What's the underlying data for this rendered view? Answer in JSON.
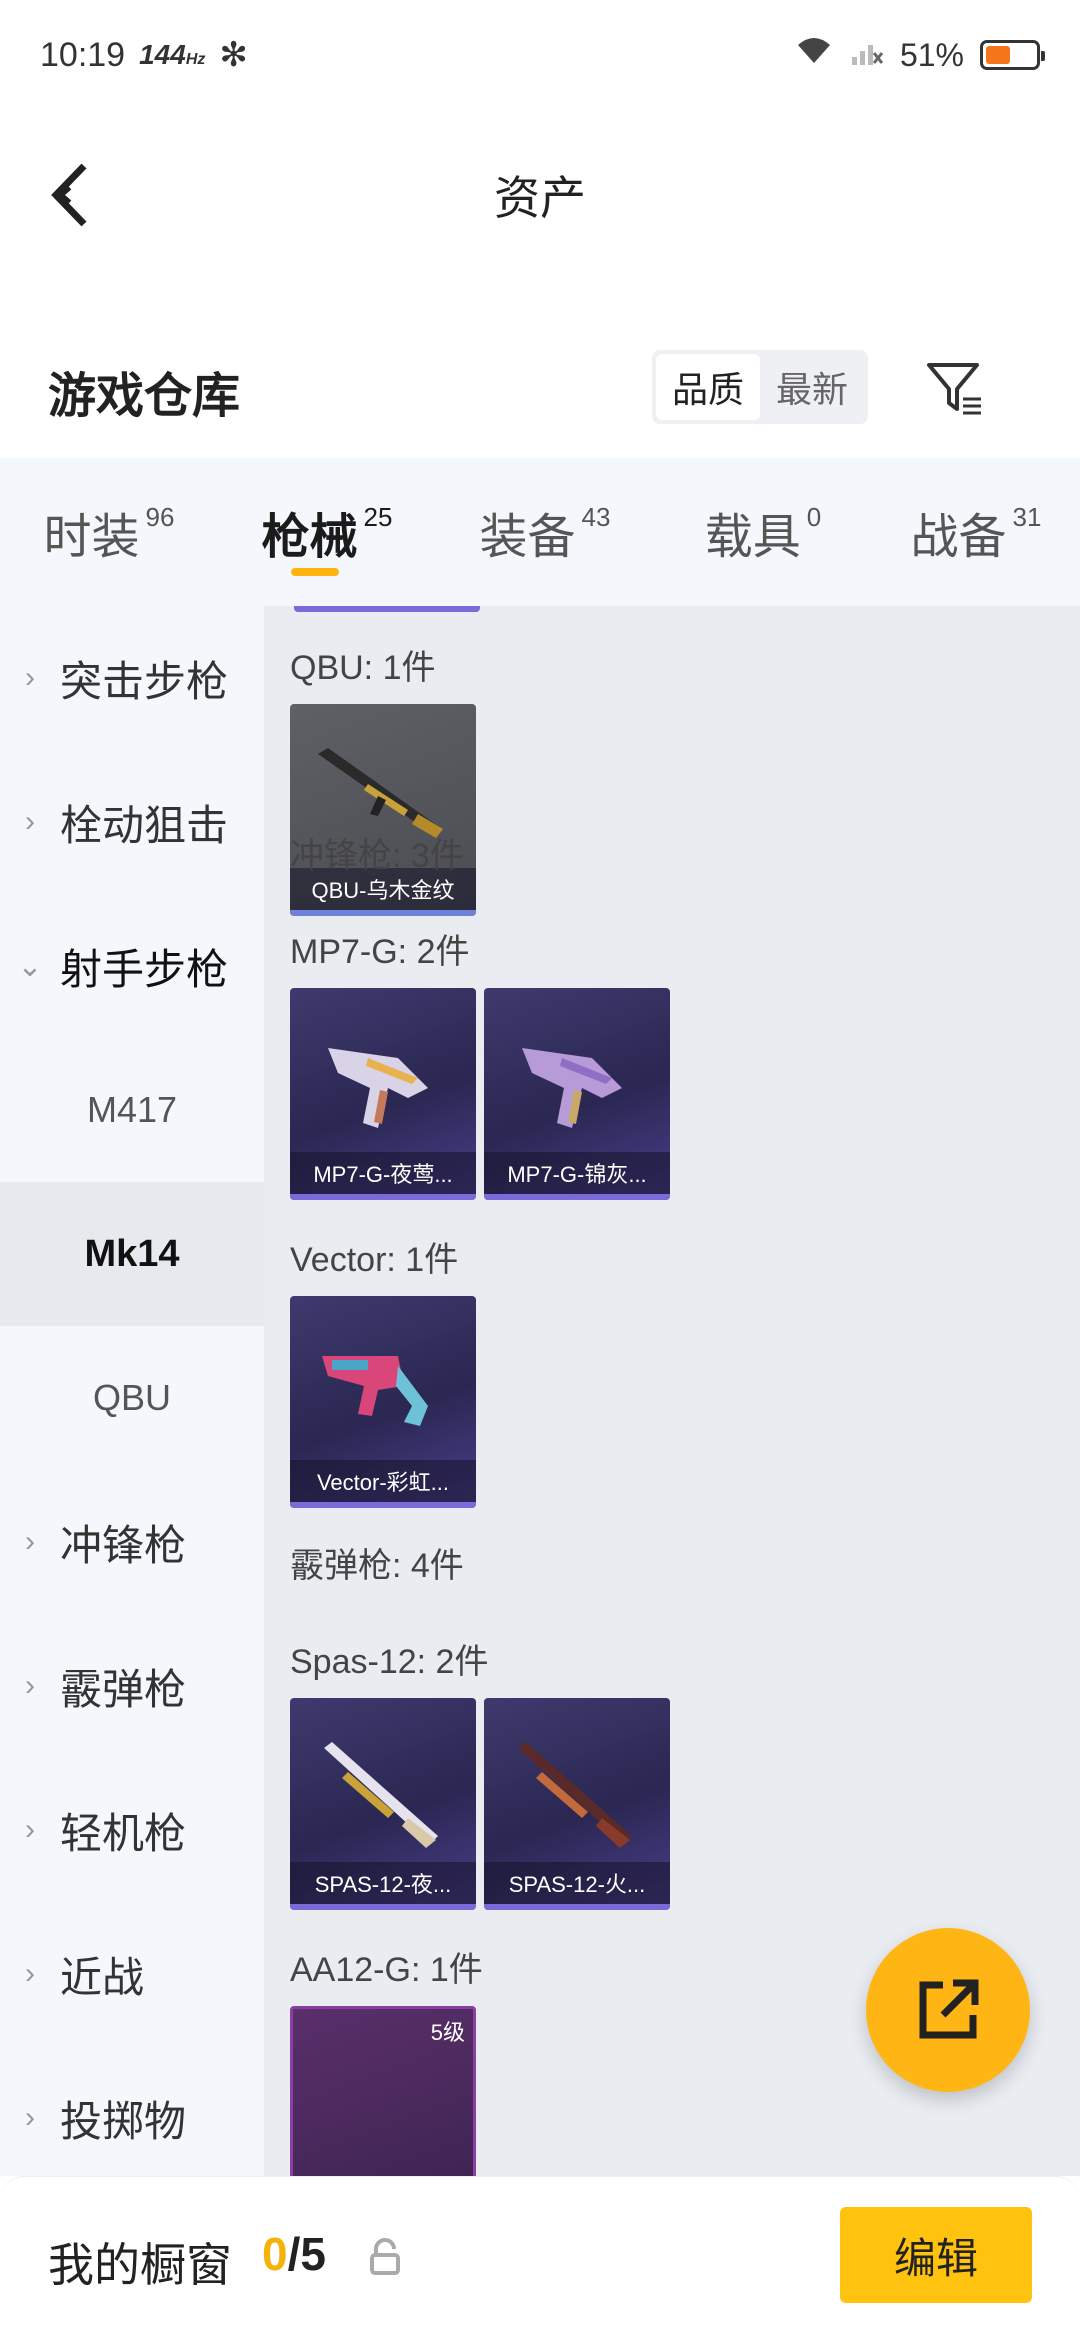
{
  "status": {
    "time": "10:19",
    "refresh_rate": "144",
    "refresh_unit": "Hz",
    "battery": "51%",
    "battery_level": 0.51
  },
  "header": {
    "title": "资产"
  },
  "warehouse": {
    "title": "游戏仓库",
    "sort_options": [
      "品质",
      "最新"
    ],
    "sort_selected": "品质"
  },
  "tabs": [
    {
      "label": "时装",
      "count": "96"
    },
    {
      "label": "枪械",
      "count": "25",
      "active": true
    },
    {
      "label": "装备",
      "count": "43"
    },
    {
      "label": "载具",
      "count": "0"
    },
    {
      "label": "战备",
      "count": "31"
    }
  ],
  "sidebar": {
    "categories": [
      {
        "label": "突击步枪"
      },
      {
        "label": "栓动狙击"
      },
      {
        "label": "射手步枪",
        "open": true
      },
      {
        "label": "冲锋枪"
      },
      {
        "label": "霰弹枪"
      },
      {
        "label": "轻机枪"
      },
      {
        "label": "近战"
      },
      {
        "label": "投掷物"
      }
    ],
    "subitems": [
      {
        "label": "M417"
      },
      {
        "label": "Mk14",
        "selected": true
      },
      {
        "label": "QBU"
      }
    ]
  },
  "content": {
    "groups": [
      {
        "title": "QBU: 1件",
        "items": [
          "QBU-乌木金纹"
        ]
      },
      {
        "title": "冲锋枪: 3件"
      },
      {
        "title": "MP7-G: 2件",
        "items": [
          "MP7-G-夜莺...",
          "MP7-G-锦灰..."
        ]
      },
      {
        "title": "Vector: 1件",
        "items": [
          "Vector-彩虹..."
        ]
      },
      {
        "title": "霰弹枪: 4件"
      },
      {
        "title": "Spas-12: 2件",
        "items": [
          "SPAS-12-夜...",
          "SPAS-12-火..."
        ]
      },
      {
        "title": "AA12-G: 1件",
        "items_level": [
          "5级"
        ]
      }
    ]
  },
  "bottom": {
    "title": "我的橱窗",
    "used": "0",
    "separator": "/",
    "total": "5",
    "edit_label": "编辑"
  },
  "colors": {
    "accent": "#ffc20e",
    "fab": "#ffb513",
    "tab_indicator": "#ffb30f",
    "sidebar_bg": "#f4f7fb",
    "content_bg": "#e9ecf1"
  }
}
